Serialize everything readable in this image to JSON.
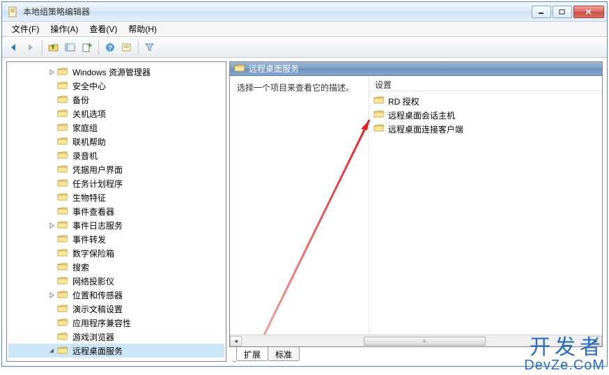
{
  "window": {
    "title": "本地组策略编辑器"
  },
  "menu": {
    "file": "文件(F)",
    "action": "操作(A)",
    "view": "查看(V)",
    "help": "帮助(H)"
  },
  "toolbar_icons": {
    "back": "back-icon",
    "forward": "forward-icon",
    "up": "up-folder-icon",
    "show": "show-pane-icon",
    "export": "export-list-icon",
    "help": "help-icon",
    "properties": "properties-icon",
    "filter": "filter-icon"
  },
  "tree": [
    {
      "label": "Windows 资源管理器",
      "expandable": true
    },
    {
      "label": "安全中心",
      "expandable": false
    },
    {
      "label": "备份",
      "expandable": false
    },
    {
      "label": "关机选项",
      "expandable": false
    },
    {
      "label": "家庭组",
      "expandable": false
    },
    {
      "label": "联机帮助",
      "expandable": false
    },
    {
      "label": "录音机",
      "expandable": false
    },
    {
      "label": "凭据用户界面",
      "expandable": false
    },
    {
      "label": "任务计划程序",
      "expandable": false
    },
    {
      "label": "生物特征",
      "expandable": false
    },
    {
      "label": "事件查看器",
      "expandable": false
    },
    {
      "label": "事件日志服务",
      "expandable": true
    },
    {
      "label": "事件转发",
      "expandable": false
    },
    {
      "label": "数字保险箱",
      "expandable": false
    },
    {
      "label": "搜索",
      "expandable": false
    },
    {
      "label": "网络投影仪",
      "expandable": false
    },
    {
      "label": "位置和传感器",
      "expandable": true
    },
    {
      "label": "演示文稿设置",
      "expandable": false
    },
    {
      "label": "应用程序兼容性",
      "expandable": false
    },
    {
      "label": "游戏浏览器",
      "expandable": false
    },
    {
      "label": "远程桌面服务",
      "expandable": true,
      "expanded": true,
      "selected": true
    }
  ],
  "details": {
    "header": "远程桌面服务",
    "description": "选择一个项目来查看它的描述。",
    "settings_header": "设置",
    "items": [
      {
        "label": "RD 授权"
      },
      {
        "label": "远程桌面会话主机"
      },
      {
        "label": "远程桌面连接客户端"
      }
    ]
  },
  "tabs": {
    "extended": "扩展",
    "standard": "标准"
  },
  "watermark": {
    "line1": "开发者",
    "line2": "DevZe.CoM"
  }
}
